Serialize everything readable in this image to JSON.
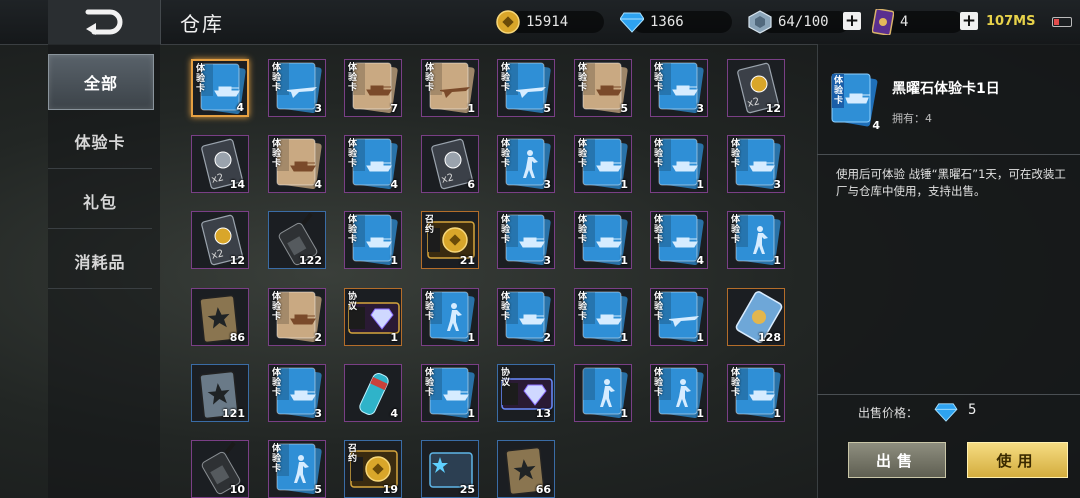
{
  "header": {
    "title": "仓库",
    "currencies": [
      {
        "name": "gold-coin-icon",
        "value": "15914"
      },
      {
        "name": "diamond-icon",
        "value": "1366"
      },
      {
        "name": "crystal-box-icon",
        "value": "64/100"
      },
      {
        "name": "card-ticket-icon",
        "value": "4"
      }
    ],
    "ping": "107MS"
  },
  "nav": {
    "items": [
      {
        "label": "全部",
        "active": true
      },
      {
        "label": "体验卡",
        "active": false
      },
      {
        "label": "礼包",
        "active": false
      },
      {
        "label": "消耗品",
        "active": false
      }
    ]
  },
  "grid": {
    "items": [
      {
        "icon": "tank-trial-card-icon",
        "badge": "体验卡",
        "count": "4",
        "frame": "blue",
        "selected": true
      },
      {
        "icon": "plane-trial-card-icon",
        "badge": "体验卡",
        "count": "3",
        "frame": "purple"
      },
      {
        "icon": "tank-trial-card-icon",
        "badge": "体验卡",
        "count": "7",
        "frame": "purple"
      },
      {
        "icon": "plane-trial-card-icon",
        "badge": "体验卡",
        "count": "1",
        "frame": "purple"
      },
      {
        "icon": "plane-trial-card-icon",
        "badge": "体验卡",
        "count": "5",
        "frame": "purple"
      },
      {
        "icon": "tank-trial-card-icon",
        "badge": "体验卡",
        "count": "5",
        "frame": "purple"
      },
      {
        "icon": "tank-trial-card-icon",
        "badge": "体验卡",
        "count": "3",
        "frame": "purple"
      },
      {
        "icon": "gold-x2-card-icon",
        "badge": "",
        "count": "12",
        "frame": "purple"
      },
      {
        "icon": "silver-x2-card-icon",
        "badge": "",
        "count": "14",
        "frame": "purple"
      },
      {
        "icon": "tank-trial-card-icon",
        "badge": "体验卡",
        "count": "4",
        "frame": "purple"
      },
      {
        "icon": "tank-trial-card-icon",
        "badge": "体验卡",
        "count": "4",
        "frame": "purple"
      },
      {
        "icon": "silver-x2-card-icon",
        "badge": "",
        "count": "6",
        "frame": "purple"
      },
      {
        "icon": "soldier-trial-card-icon",
        "badge": "体验卡",
        "count": "3",
        "frame": "purple"
      },
      {
        "icon": "tank-trial-card-icon",
        "badge": "体验卡",
        "count": "1",
        "frame": "purple"
      },
      {
        "icon": "tank-trial-card-icon",
        "badge": "体验卡",
        "count": "1",
        "frame": "purple"
      },
      {
        "icon": "tank-trial-card-icon",
        "badge": "体验卡",
        "count": "3",
        "frame": "purple"
      },
      {
        "icon": "gold-x2-card-icon",
        "badge": "",
        "count": "12",
        "frame": "purple"
      },
      {
        "icon": "radio-icon",
        "badge": "",
        "count": "122",
        "frame": "blue"
      },
      {
        "icon": "tank-trial-card-icon",
        "badge": "体验卡",
        "count": "1",
        "frame": "purple"
      },
      {
        "icon": "summon-coin-card-icon",
        "badge": "召约",
        "count": "21",
        "frame": "gold"
      },
      {
        "icon": "tank-trial-card-icon",
        "badge": "体验卡",
        "count": "3",
        "frame": "purple"
      },
      {
        "icon": "tank-trial-card-icon",
        "badge": "体验卡",
        "count": "1",
        "frame": "purple"
      },
      {
        "icon": "tank-trial-card-icon",
        "badge": "体验卡",
        "count": "4",
        "frame": "purple"
      },
      {
        "icon": "soldier-trial-card-icon",
        "badge": "体验卡",
        "count": "1",
        "frame": "purple"
      },
      {
        "icon": "star-book-icon",
        "badge": "",
        "count": "86",
        "frame": "purple"
      },
      {
        "icon": "tank-trial-card-icon",
        "badge": "体验卡",
        "count": "2",
        "frame": "purple"
      },
      {
        "icon": "protocol-diamond-card-icon",
        "badge": "协议",
        "count": "1",
        "frame": "gold"
      },
      {
        "icon": "soldier-trial-card-icon",
        "badge": "体验卡",
        "count": "1",
        "frame": "purple"
      },
      {
        "icon": "tank-trial-card-icon",
        "badge": "体验卡",
        "count": "2",
        "frame": "purple"
      },
      {
        "icon": "tank-trial-card-icon",
        "badge": "体验卡",
        "count": "1",
        "frame": "purple"
      },
      {
        "icon": "plane-trial-card-icon",
        "badge": "体验卡",
        "count": "1",
        "frame": "purple"
      },
      {
        "icon": "blue-ticket-icon",
        "badge": "",
        "count": "128",
        "frame": "gold"
      },
      {
        "icon": "steel-book-icon",
        "badge": "",
        "count": "121",
        "frame": "blue"
      },
      {
        "icon": "tank-trial-card-icon",
        "badge": "体验卡",
        "count": "3",
        "frame": "purple"
      },
      {
        "icon": "canister-icon",
        "badge": "",
        "count": "4",
        "frame": "purple"
      },
      {
        "icon": "tank-trial-card-icon",
        "badge": "体验卡",
        "count": "1",
        "frame": "purple"
      },
      {
        "icon": "protocol-diamond-card-icon",
        "badge": "协议",
        "count": "13",
        "frame": "blue"
      },
      {
        "icon": "soldier-trial-card-icon",
        "badge": "",
        "count": "1",
        "frame": "purple"
      },
      {
        "icon": "soldier-trial-card-icon",
        "badge": "体验卡",
        "count": "1",
        "frame": "purple"
      },
      {
        "icon": "tank-trial-card-icon",
        "badge": "体验卡",
        "count": "1",
        "frame": "purple"
      },
      {
        "icon": "radio-icon",
        "badge": "",
        "count": "10",
        "frame": "purple"
      },
      {
        "icon": "soldier-trial-card-icon",
        "badge": "体验卡",
        "count": "5",
        "frame": "purple"
      },
      {
        "icon": "summon-coin-card-icon",
        "badge": "召约",
        "count": "19",
        "frame": "blue"
      },
      {
        "icon": "star-box-icon",
        "badge": "",
        "count": "25",
        "frame": "blue"
      },
      {
        "icon": "star-book-icon",
        "badge": "",
        "count": "66",
        "frame": "blue"
      }
    ]
  },
  "detail": {
    "badge": "体验卡",
    "count": "4",
    "name": "黑曜石体验卡1日",
    "owned": "拥有：4",
    "description": "使用后可体验 战锤“黑曜石”1天，可在改装工厂与仓库中使用，支持出售。",
    "price_label": "出售价格：",
    "price": "5",
    "sell_label": "出售",
    "use_label": "使用"
  },
  "colors": {
    "accent_gold": "#e6a042",
    "card_blue": "#2f8fd6",
    "frame_purple": "#7a3f86"
  }
}
